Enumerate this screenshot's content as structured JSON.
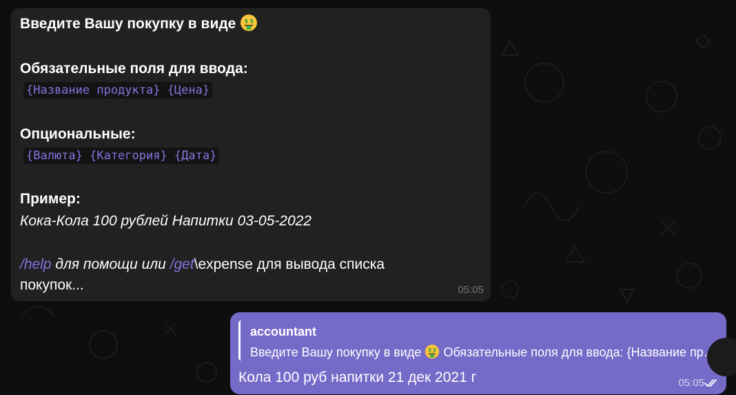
{
  "incoming": {
    "title": "Введите Вашу покупку в виде",
    "required_label": "Обязательные поля для ввода:",
    "required_fields": "{Название продукта} {Цена}",
    "optional_label": "Опциональные:",
    "optional_fields": "{Валюта} {Категория} {Дата}",
    "example_label": "Пример:",
    "example_text": "Кока-Кола 100 рублей Напитки 03-05-2022",
    "help_cmd": "/help",
    "help_text": " для помощи или ",
    "get_cmd": "/get",
    "get_rest": "\\expense для вывода списка",
    "line_end": "покупок...",
    "time": "05:05"
  },
  "outgoing": {
    "reply_author": "accountant",
    "reply_text_before_emoji": "Введите Вашу покупку в виде",
    "reply_text_after_emoji": "Обязательные поля для ввода: {Название продукта} {Цена}",
    "message": "Кола 100 руб напитки 21 дек 2021 г",
    "time": "05:05"
  },
  "icons": {
    "emoji": "money-mouth-face-icon",
    "read_status": "double-check-icon"
  },
  "colors": {
    "background": "#0e0e0e",
    "incoming_bubble": "#212121",
    "outgoing_bubble": "#766ac8",
    "accent": "#8774e1",
    "code_bg": "#131313"
  }
}
